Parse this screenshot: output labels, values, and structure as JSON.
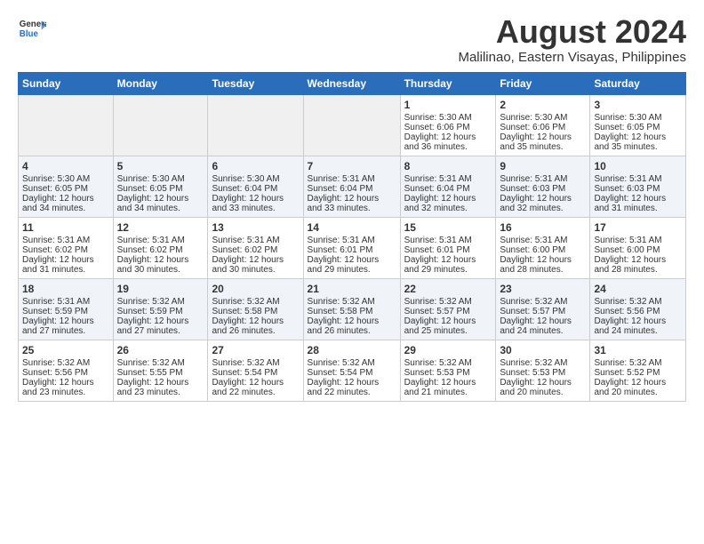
{
  "logo": {
    "line1": "General",
    "line2": "Blue"
  },
  "title": "August 2024",
  "subtitle": "Malilinao, Eastern Visayas, Philippines",
  "days_header": [
    "Sunday",
    "Monday",
    "Tuesday",
    "Wednesday",
    "Thursday",
    "Friday",
    "Saturday"
  ],
  "weeks": [
    [
      {
        "num": "",
        "empty": true
      },
      {
        "num": "",
        "empty": true
      },
      {
        "num": "",
        "empty": true
      },
      {
        "num": "",
        "empty": true
      },
      {
        "num": "1",
        "rise": "5:30 AM",
        "set": "6:06 PM",
        "daylight": "12 hours and 36 minutes."
      },
      {
        "num": "2",
        "rise": "5:30 AM",
        "set": "6:06 PM",
        "daylight": "12 hours and 35 minutes."
      },
      {
        "num": "3",
        "rise": "5:30 AM",
        "set": "6:05 PM",
        "daylight": "12 hours and 35 minutes."
      }
    ],
    [
      {
        "num": "4",
        "rise": "5:30 AM",
        "set": "6:05 PM",
        "daylight": "12 hours and 34 minutes."
      },
      {
        "num": "5",
        "rise": "5:30 AM",
        "set": "6:05 PM",
        "daylight": "12 hours and 34 minutes."
      },
      {
        "num": "6",
        "rise": "5:30 AM",
        "set": "6:04 PM",
        "daylight": "12 hours and 33 minutes."
      },
      {
        "num": "7",
        "rise": "5:31 AM",
        "set": "6:04 PM",
        "daylight": "12 hours and 33 minutes."
      },
      {
        "num": "8",
        "rise": "5:31 AM",
        "set": "6:04 PM",
        "daylight": "12 hours and 32 minutes."
      },
      {
        "num": "9",
        "rise": "5:31 AM",
        "set": "6:03 PM",
        "daylight": "12 hours and 32 minutes."
      },
      {
        "num": "10",
        "rise": "5:31 AM",
        "set": "6:03 PM",
        "daylight": "12 hours and 31 minutes."
      }
    ],
    [
      {
        "num": "11",
        "rise": "5:31 AM",
        "set": "6:02 PM",
        "daylight": "12 hours and 31 minutes."
      },
      {
        "num": "12",
        "rise": "5:31 AM",
        "set": "6:02 PM",
        "daylight": "12 hours and 30 minutes."
      },
      {
        "num": "13",
        "rise": "5:31 AM",
        "set": "6:02 PM",
        "daylight": "12 hours and 30 minutes."
      },
      {
        "num": "14",
        "rise": "5:31 AM",
        "set": "6:01 PM",
        "daylight": "12 hours and 29 minutes."
      },
      {
        "num": "15",
        "rise": "5:31 AM",
        "set": "6:01 PM",
        "daylight": "12 hours and 29 minutes."
      },
      {
        "num": "16",
        "rise": "5:31 AM",
        "set": "6:00 PM",
        "daylight": "12 hours and 28 minutes."
      },
      {
        "num": "17",
        "rise": "5:31 AM",
        "set": "6:00 PM",
        "daylight": "12 hours and 28 minutes."
      }
    ],
    [
      {
        "num": "18",
        "rise": "5:31 AM",
        "set": "5:59 PM",
        "daylight": "12 hours and 27 minutes."
      },
      {
        "num": "19",
        "rise": "5:32 AM",
        "set": "5:59 PM",
        "daylight": "12 hours and 27 minutes."
      },
      {
        "num": "20",
        "rise": "5:32 AM",
        "set": "5:58 PM",
        "daylight": "12 hours and 26 minutes."
      },
      {
        "num": "21",
        "rise": "5:32 AM",
        "set": "5:58 PM",
        "daylight": "12 hours and 26 minutes."
      },
      {
        "num": "22",
        "rise": "5:32 AM",
        "set": "5:57 PM",
        "daylight": "12 hours and 25 minutes."
      },
      {
        "num": "23",
        "rise": "5:32 AM",
        "set": "5:57 PM",
        "daylight": "12 hours and 24 minutes."
      },
      {
        "num": "24",
        "rise": "5:32 AM",
        "set": "5:56 PM",
        "daylight": "12 hours and 24 minutes."
      }
    ],
    [
      {
        "num": "25",
        "rise": "5:32 AM",
        "set": "5:56 PM",
        "daylight": "12 hours and 23 minutes."
      },
      {
        "num": "26",
        "rise": "5:32 AM",
        "set": "5:55 PM",
        "daylight": "12 hours and 23 minutes."
      },
      {
        "num": "27",
        "rise": "5:32 AM",
        "set": "5:54 PM",
        "daylight": "12 hours and 22 minutes."
      },
      {
        "num": "28",
        "rise": "5:32 AM",
        "set": "5:54 PM",
        "daylight": "12 hours and 22 minutes."
      },
      {
        "num": "29",
        "rise": "5:32 AM",
        "set": "5:53 PM",
        "daylight": "12 hours and 21 minutes."
      },
      {
        "num": "30",
        "rise": "5:32 AM",
        "set": "5:53 PM",
        "daylight": "12 hours and 20 minutes."
      },
      {
        "num": "31",
        "rise": "5:32 AM",
        "set": "5:52 PM",
        "daylight": "12 hours and 20 minutes."
      }
    ]
  ],
  "labels": {
    "sunrise": "Sunrise:",
    "sunset": "Sunset:",
    "daylight": "Daylight:"
  }
}
